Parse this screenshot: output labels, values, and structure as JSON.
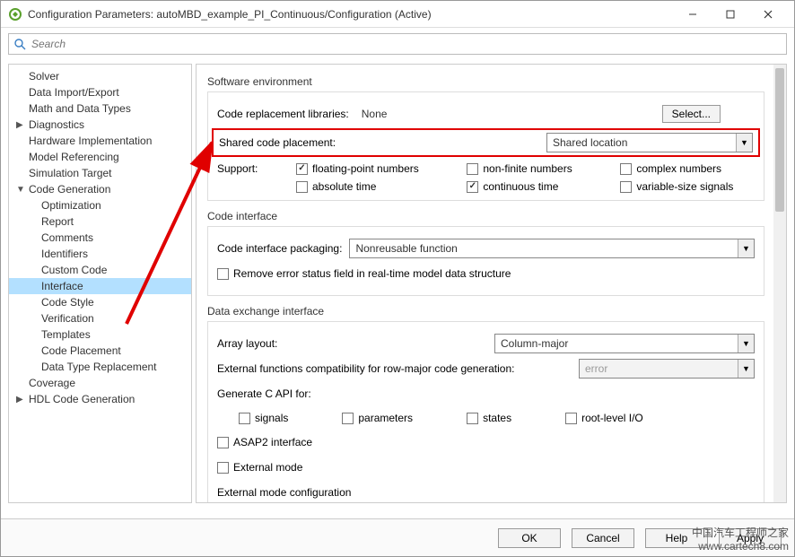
{
  "window": {
    "title": "Configuration Parameters: autoMBD_example_PI_Continuous/Configuration (Active)"
  },
  "search": {
    "placeholder": "Search"
  },
  "tree": {
    "items": [
      {
        "label": "Solver",
        "indent": 0,
        "hasChildren": false
      },
      {
        "label": "Data Import/Export",
        "indent": 0,
        "hasChildren": false
      },
      {
        "label": "Math and Data Types",
        "indent": 0,
        "hasChildren": false
      },
      {
        "label": "Diagnostics",
        "indent": 0,
        "hasChildren": true
      },
      {
        "label": "Hardware Implementation",
        "indent": 0,
        "hasChildren": false
      },
      {
        "label": "Model Referencing",
        "indent": 0,
        "hasChildren": false
      },
      {
        "label": "Simulation Target",
        "indent": 0,
        "hasChildren": false
      },
      {
        "label": "Code Generation",
        "indent": 0,
        "hasChildren": true,
        "expanded": true
      },
      {
        "label": "Optimization",
        "indent": 1,
        "hasChildren": false
      },
      {
        "label": "Report",
        "indent": 1,
        "hasChildren": false
      },
      {
        "label": "Comments",
        "indent": 1,
        "hasChildren": false
      },
      {
        "label": "Identifiers",
        "indent": 1,
        "hasChildren": false
      },
      {
        "label": "Custom Code",
        "indent": 1,
        "hasChildren": false
      },
      {
        "label": "Interface",
        "indent": 1,
        "hasChildren": false,
        "selected": true
      },
      {
        "label": "Code Style",
        "indent": 1,
        "hasChildren": false
      },
      {
        "label": "Verification",
        "indent": 1,
        "hasChildren": false
      },
      {
        "label": "Templates",
        "indent": 1,
        "hasChildren": false
      },
      {
        "label": "Code Placement",
        "indent": 1,
        "hasChildren": false
      },
      {
        "label": "Data Type Replacement",
        "indent": 1,
        "hasChildren": false
      },
      {
        "label": "Coverage",
        "indent": 0,
        "hasChildren": false
      },
      {
        "label": "HDL Code Generation",
        "indent": 0,
        "hasChildren": true
      }
    ]
  },
  "sections": {
    "software_env": {
      "title": "Software environment",
      "crl_label": "Code replacement libraries:",
      "crl_value": "None",
      "select_btn": "Select...",
      "scp_label": "Shared code placement:",
      "scp_value": "Shared location",
      "support_label": "Support:",
      "opts": {
        "fp": "floating-point numbers",
        "nonfinite": "non-finite numbers",
        "complex": "complex numbers",
        "abstime": "absolute time",
        "conttime": "continuous time",
        "varsize": "variable-size signals"
      }
    },
    "code_iface": {
      "title": "Code interface",
      "pkg_label": "Code interface packaging:",
      "pkg_value": "Nonreusable function",
      "remove_err": "Remove error status field in real-time model data structure"
    },
    "data_ex": {
      "title": "Data exchange interface",
      "arr_label": "Array layout:",
      "arr_value": "Column-major",
      "ext_fn_label": "External functions compatibility for row-major code generation:",
      "ext_fn_value": "error",
      "gen_api_label": "Generate C API for:",
      "api": {
        "signals": "signals",
        "parameters": "parameters",
        "states": "states",
        "root": "root-level I/O"
      },
      "asap2": "ASAP2 interface",
      "extmode": "External mode",
      "extmode_cfg": "External mode configuration"
    }
  },
  "footer": {
    "ok": "OK",
    "cancel": "Cancel",
    "help": "Help",
    "apply": "Apply"
  },
  "watermark": {
    "line1": "中国汽车工程师之家",
    "line2": "www.cartech8.com"
  }
}
